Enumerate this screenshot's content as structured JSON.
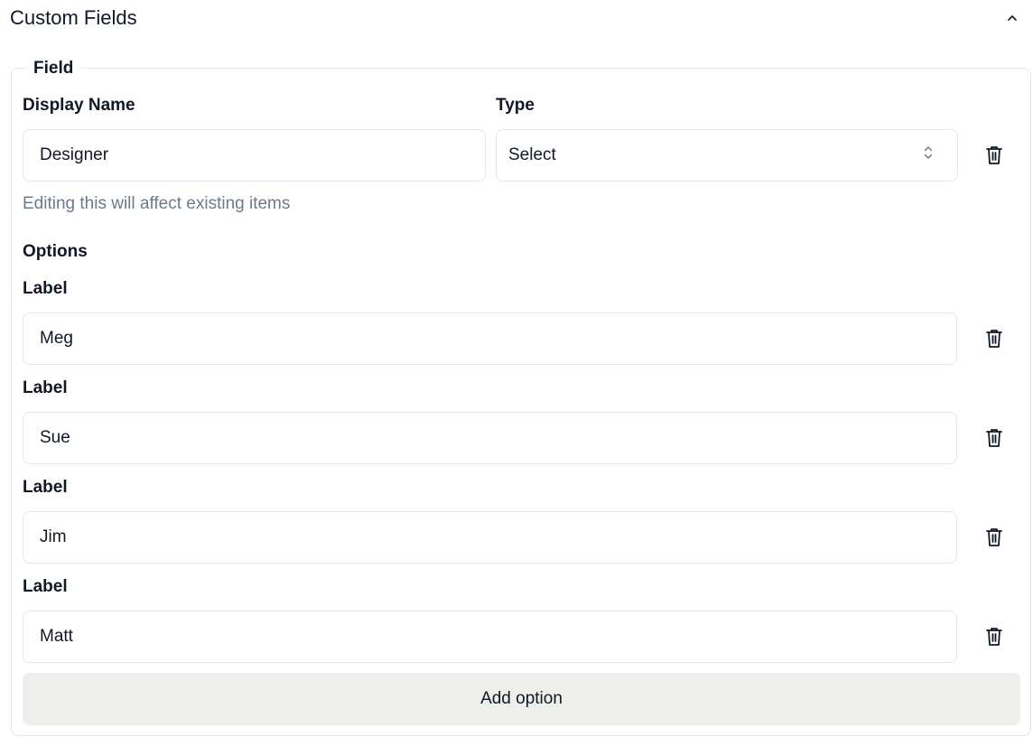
{
  "header": {
    "title": "Custom Fields",
    "collapse_icon": "chevron-up-icon"
  },
  "field": {
    "legend": "Field",
    "display_name_label": "Display Name",
    "display_name_value": "Designer",
    "type_label": "Type",
    "type_value": "Select",
    "hint": "Editing this will affect existing items",
    "delete_icon": "trash-icon"
  },
  "options": {
    "heading": "Options",
    "items": [
      {
        "label": "Label",
        "value": "Meg"
      },
      {
        "label": "Label",
        "value": "Sue"
      },
      {
        "label": "Label",
        "value": "Jim"
      },
      {
        "label": "Label",
        "value": "Matt"
      }
    ],
    "add_label": "Add option"
  },
  "colors": {
    "border": "#e5e7eb",
    "hint": "#6b7b8c",
    "button_bg": "#eeeeea",
    "text": "#111827"
  }
}
